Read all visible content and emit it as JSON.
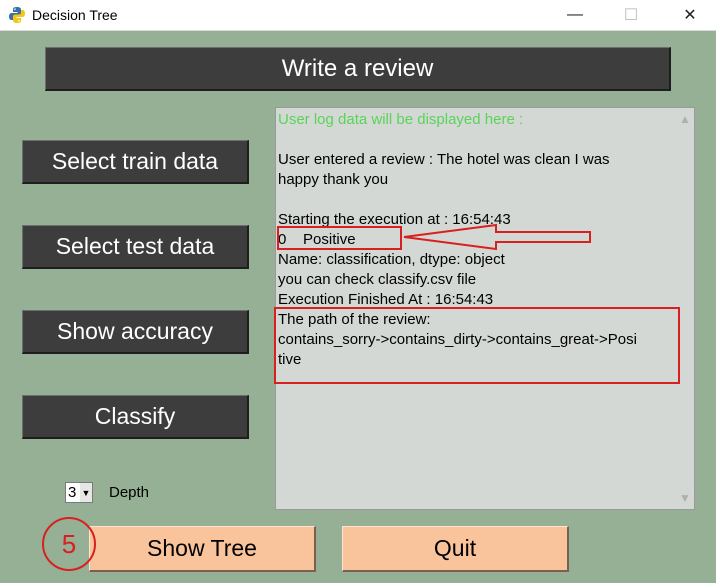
{
  "window": {
    "title": "Decision Tree",
    "icon": "python-logo-icon",
    "minimize_glyph": "—",
    "maximize_glyph": "☐",
    "close_glyph": "✕"
  },
  "header": {
    "write_review_label": "Write a review"
  },
  "sidebar": {
    "buttons": [
      {
        "label": "Select train data"
      },
      {
        "label": "Select test data"
      },
      {
        "label": "Show accuracy"
      },
      {
        "label": "Classify"
      }
    ]
  },
  "log": {
    "lines": [
      "User log data will be displayed here :",
      "",
      "User entered a review : The hotel was clean I was",
      "happy thank you",
      "",
      "Starting the execution at : 16:54:43",
      "0    Positive",
      "Name: classification, dtype: object",
      "you can check classify.csv file",
      "Execution Finished At : 16:54:43",
      "The path of the review:",
      "contains_sorry->contains_dirty->contains_great->Posi",
      "tive"
    ],
    "header_color": "#58d458"
  },
  "depth": {
    "value": "3",
    "label": "Depth"
  },
  "footer": {
    "show_tree_label": "Show Tree",
    "quit_label": "Quit",
    "step_marker": "5"
  },
  "colors": {
    "background": "#95b095",
    "dark_button": "#3d3d3d",
    "peach_button": "#f9c39b",
    "annotation_red": "#d82020"
  }
}
